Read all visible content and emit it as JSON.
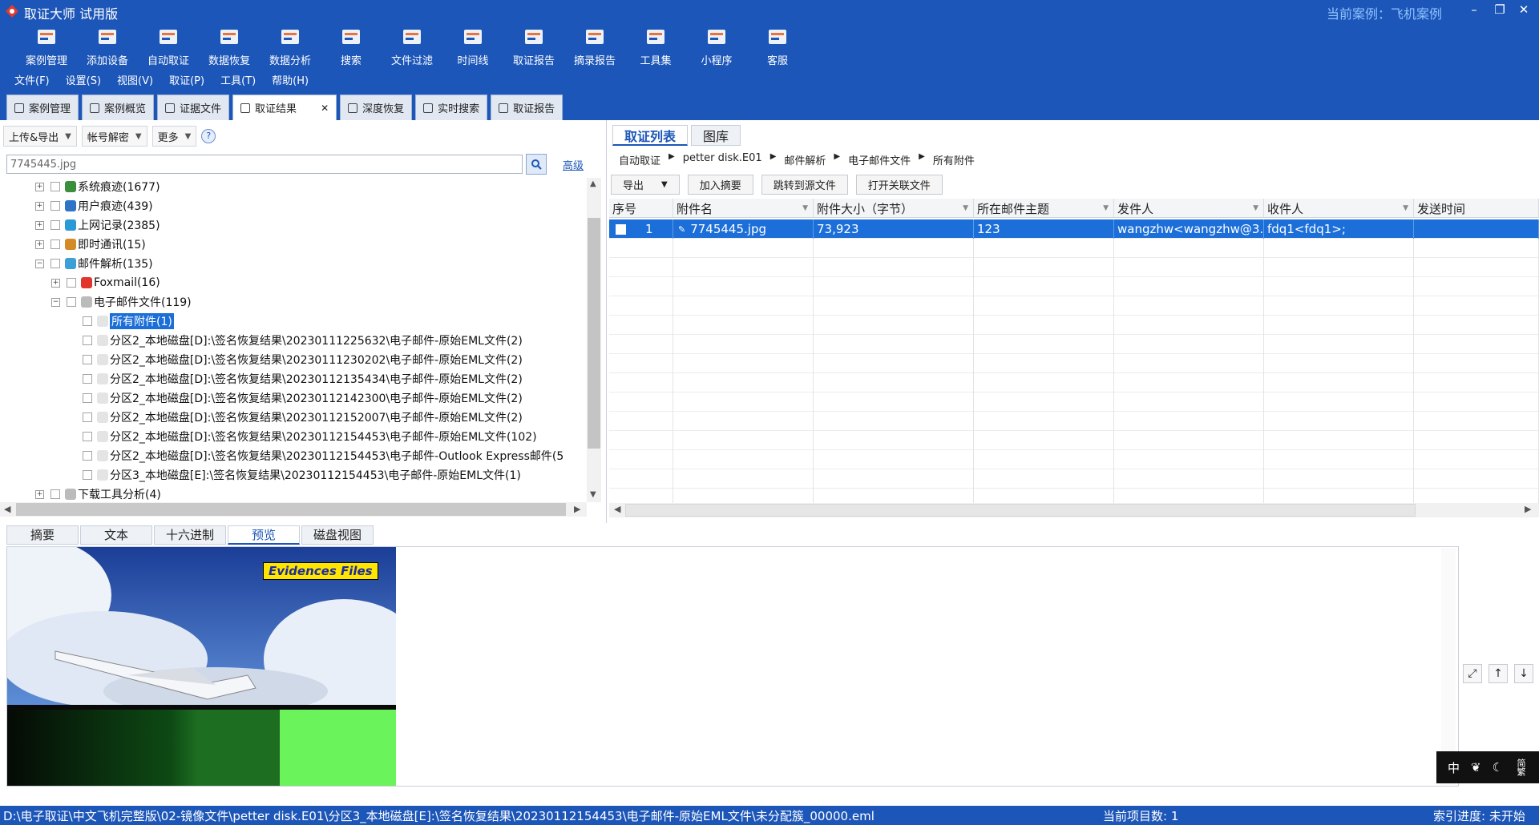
{
  "app": {
    "title": "取证大师 试用版",
    "case_label": "当前案例：飞机案例",
    "colors": {
      "primary": "#1c56b8",
      "selection": "#1c6fd8"
    }
  },
  "ribbon": [
    {
      "label": "案例管理",
      "icon": "case-manage-icon"
    },
    {
      "label": "添加设备",
      "icon": "add-device-icon"
    },
    {
      "label": "自动取证",
      "icon": "auto-forensics-icon"
    },
    {
      "label": "数据恢复",
      "icon": "data-recovery-icon"
    },
    {
      "label": "数据分析",
      "icon": "data-analysis-icon"
    },
    {
      "label": "搜索",
      "icon": "search-icon"
    },
    {
      "label": "文件过滤",
      "icon": "file-filter-icon"
    },
    {
      "label": "时间线",
      "icon": "timeline-icon"
    },
    {
      "label": "取证报告",
      "icon": "report-icon"
    },
    {
      "label": "摘录报告",
      "icon": "excerpt-report-icon"
    },
    {
      "label": "工具集",
      "icon": "toolset-icon"
    },
    {
      "label": "小程序",
      "icon": "mini-program-icon"
    },
    {
      "label": "客服",
      "icon": "support-icon"
    }
  ],
  "menu": [
    "文件(F)",
    "设置(S)",
    "视图(V)",
    "取证(P)",
    "工具(T)",
    "帮助(H)"
  ],
  "tabs": [
    {
      "label": "案例管理"
    },
    {
      "label": "案例概览"
    },
    {
      "label": "证据文件"
    },
    {
      "label": "取证结果",
      "active": true,
      "closable": true
    },
    {
      "label": "深度恢复"
    },
    {
      "label": "实时搜索"
    },
    {
      "label": "取证报告"
    }
  ],
  "left": {
    "toolbar": [
      "上传&导出",
      "帐号解密",
      "更多"
    ],
    "help": "?",
    "search_value": "7745445.jpg",
    "advanced": "高级",
    "tree": [
      {
        "label": "系统痕迹(1677)",
        "exp": "+",
        "indent": 0
      },
      {
        "label": "用户痕迹(439)",
        "exp": "+",
        "indent": 0
      },
      {
        "label": "上网记录(2385)",
        "exp": "+",
        "indent": 0
      },
      {
        "label": "即时通讯(15)",
        "exp": "+",
        "indent": 0
      },
      {
        "label": "邮件解析(135)",
        "exp": "−",
        "indent": 0
      },
      {
        "label": "Foxmail(16)",
        "exp": "+",
        "indent": 1
      },
      {
        "label": "电子邮件文件(119)",
        "exp": "−",
        "indent": 1
      },
      {
        "label": "所有附件(1)",
        "indent": 2,
        "selected": true
      },
      {
        "label": "分区2_本地磁盘[D]:\\签名恢复结果\\20230111225632\\电子邮件-原始EML文件(2)",
        "indent": 2
      },
      {
        "label": "分区2_本地磁盘[D]:\\签名恢复结果\\20230111230202\\电子邮件-原始EML文件(2)",
        "indent": 2
      },
      {
        "label": "分区2_本地磁盘[D]:\\签名恢复结果\\20230112135434\\电子邮件-原始EML文件(2)",
        "indent": 2
      },
      {
        "label": "分区2_本地磁盘[D]:\\签名恢复结果\\20230112142300\\电子邮件-原始EML文件(2)",
        "indent": 2
      },
      {
        "label": "分区2_本地磁盘[D]:\\签名恢复结果\\20230112152007\\电子邮件-原始EML文件(2)",
        "indent": 2
      },
      {
        "label": "分区2_本地磁盘[D]:\\签名恢复结果\\20230112154453\\电子邮件-原始EML文件(102)",
        "indent": 2
      },
      {
        "label": "分区2_本地磁盘[D]:\\签名恢复结果\\20230112154453\\电子邮件-Outlook Express邮件(5",
        "indent": 2
      },
      {
        "label": "分区3_本地磁盘[E]:\\签名恢复结果\\20230112154453\\电子邮件-原始EML文件(1)",
        "indent": 2
      },
      {
        "label": "下载工具分析(4)",
        "exp": "+",
        "indent": 0
      }
    ]
  },
  "right": {
    "tabs": [
      "取证列表",
      "图库"
    ],
    "breadcrumb": [
      "自动取证",
      "petter disk.E01",
      "邮件解析",
      "电子邮件文件",
      "所有附件"
    ],
    "actions": [
      "导出",
      "加入摘要",
      "跳转到源文件",
      "打开关联文件"
    ],
    "columns": [
      "序号",
      "附件名",
      "附件大小（字节）",
      "所在邮件主题",
      "发件人",
      "收件人",
      "发送时间"
    ],
    "rows": [
      {
        "no": "1",
        "name": "7745445.jpg",
        "size": "73,923",
        "subject": "123",
        "from": "wangzhw<wangzhw@3...",
        "to": "fdq1<fdq1>;",
        "time": ""
      }
    ]
  },
  "bottom": {
    "tabs": [
      "摘要",
      "文本",
      "十六进制",
      "预览",
      "磁盘视图"
    ],
    "active_tab": "预览",
    "preview_label": "Evidences Files"
  },
  "ime": [
    "中",
    "☾"
  ],
  "ime_side": "简繁",
  "status": {
    "path": "D:\\电子取证\\中文飞机完整版\\02-镜像文件\\petter disk.E01\\分区3_本地磁盘[E]:\\签名恢复结果\\20230112154453\\电子邮件-原始EML文件\\未分配簇_00000.eml",
    "count": "当前项目数: 1",
    "index": "索引进度: 未开始"
  }
}
